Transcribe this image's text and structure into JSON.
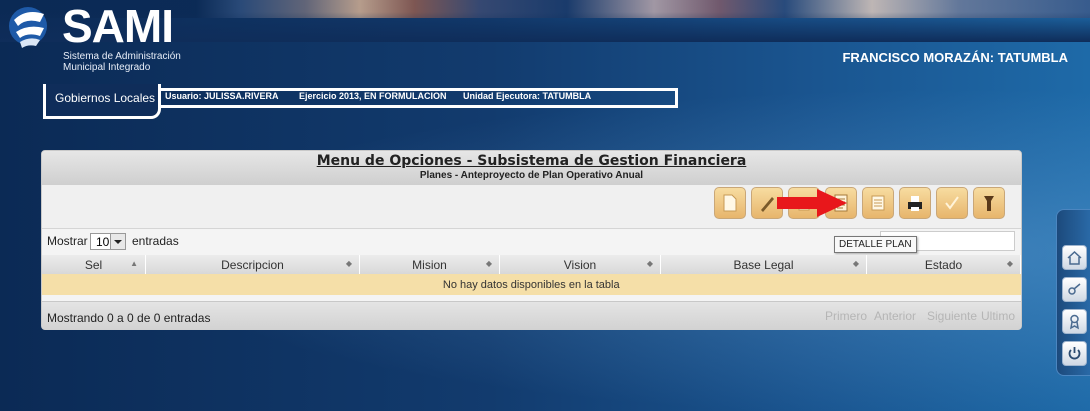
{
  "header": {
    "logo_text": "SAMI",
    "logo_subtitle_line1": "Sistema de Administración",
    "logo_subtitle_line2": "Municipal Integrado",
    "location": "FRANCISCO MORAZÁN: TATUMBLA"
  },
  "nav": {
    "active_tab": "Gobiernos Locales",
    "usuario": "Usuario: JULISSA.RIVERA",
    "ejercicio": "Ejercicio 2013, EN FORMULACION",
    "unidad": "Unidad Ejecutora: TATUMBLA"
  },
  "panel": {
    "title": "Menu de Opciones - Subsistema de Gestion Financiera",
    "subtitle": "Planes - Anteproyecto de Plan Operativo Anual"
  },
  "toolbar": {
    "buttons": [
      {
        "icon": "new-document-icon"
      },
      {
        "icon": "edit-icon"
      },
      {
        "icon": "delete-icon"
      },
      {
        "icon": "detail-plan-icon"
      },
      {
        "icon": "list-icon"
      },
      {
        "icon": "print-icon"
      },
      {
        "icon": "check-icon"
      },
      {
        "icon": "tools-icon"
      }
    ],
    "tooltip": "DETALLE PLAN"
  },
  "table_controls": {
    "show_label": "Mostrar",
    "page_size": "10",
    "entries_label": "entradas"
  },
  "table": {
    "columns": [
      "Sel",
      "Descripcion",
      "Mision",
      "Vision",
      "Base Legal",
      "Estado"
    ],
    "empty_message": "No hay datos disponibles en la tabla"
  },
  "footer": {
    "info": "Mostrando 0 a 0 de 0 entradas",
    "pager": [
      "Primero",
      "Anterior",
      "Siguiente",
      "Ultimo"
    ]
  },
  "colors": {
    "background": "#0f2d5a",
    "button_gold": "#e7b56c",
    "empty_row": "#f5dfa8",
    "arrow_red": "#e8171b"
  }
}
